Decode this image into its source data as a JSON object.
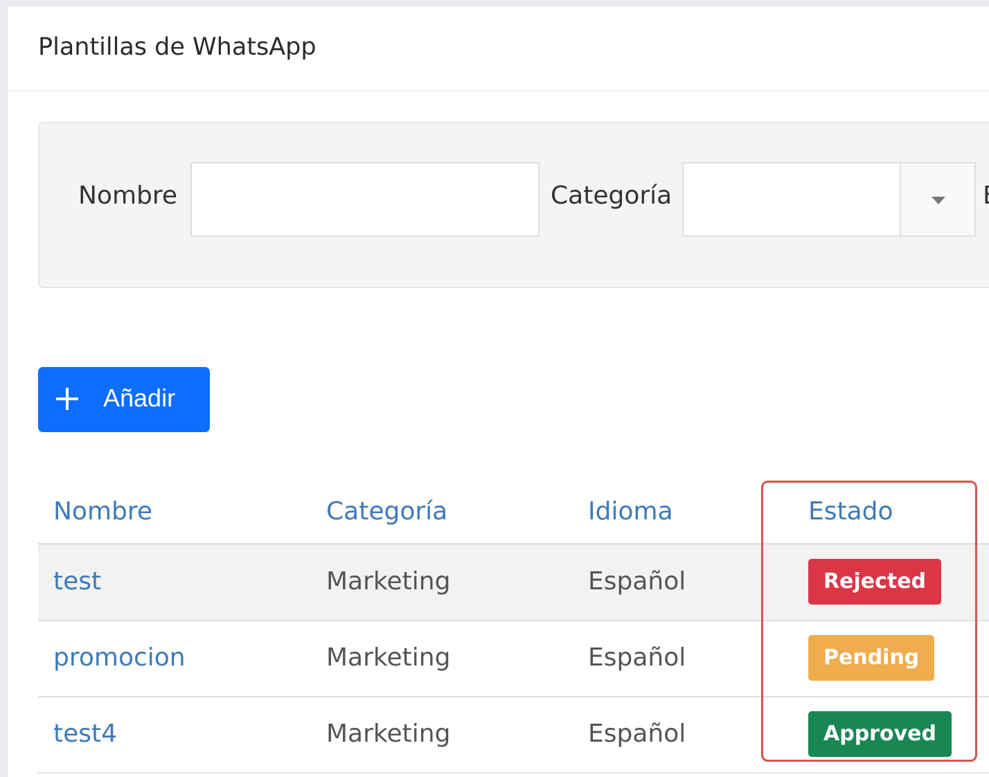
{
  "header": {
    "title": "Plantillas de WhatsApp"
  },
  "filters": {
    "name_label": "Nombre",
    "name_value": "",
    "category_label": "Categoría",
    "category_selected": "",
    "next_label_fragment": "E"
  },
  "toolbar": {
    "add_label": "Añadir"
  },
  "table": {
    "columns": [
      "Nombre",
      "Categoría",
      "Idioma",
      "Estado"
    ],
    "rows": [
      {
        "name": "test",
        "category": "Marketing",
        "language": "Español",
        "status": "Rejected",
        "status_color": "#dc3545"
      },
      {
        "name": "promocion",
        "category": "Marketing",
        "language": "Español",
        "status": "Pending",
        "status_color": "#f0ad4e"
      },
      {
        "name": "test4",
        "category": "Marketing",
        "language": "Español",
        "status": "Approved",
        "status_color": "#198754"
      }
    ]
  },
  "colors": {
    "primary": "#0d6efd",
    "link": "#3d7ab8",
    "highlight": "#d9534f"
  }
}
